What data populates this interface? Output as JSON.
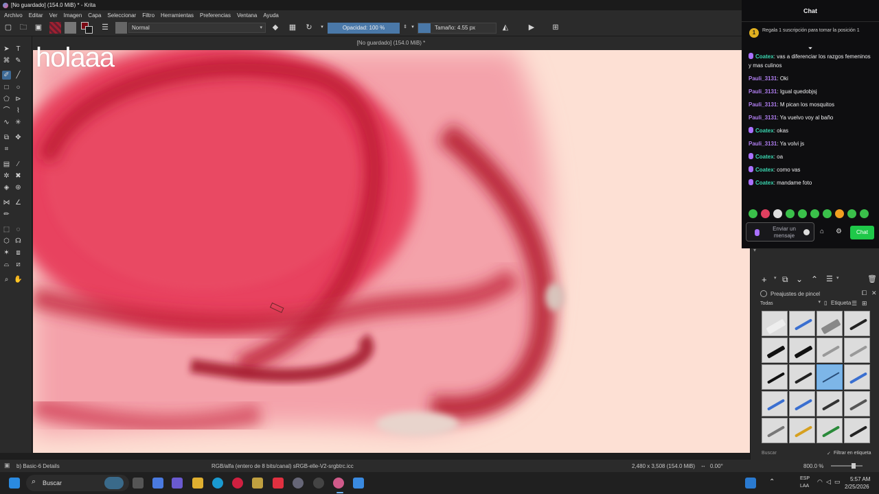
{
  "window": {
    "title": "[No guardado]  (154.0 MiB) * - Krita"
  },
  "menu": {
    "items": [
      "Archivo",
      "Editar",
      "Ver",
      "Imagen",
      "Capa",
      "Seleccionar",
      "Filtro",
      "Herramientas",
      "Preferencias",
      "Ventana",
      "Ayuda"
    ]
  },
  "toolbar": {
    "blend_mode": "Normal",
    "opacity_label": "Opacidad: 100 %",
    "opacity": 1.0,
    "size_label": "Tamaño: 4.55 px",
    "colors": {
      "foreground": "#7a0a14",
      "background": "#1a1a1a",
      "accent": "#4a78a8"
    }
  },
  "canvas": {
    "doc_title": "[No guardado]  (154.0 MiB) *",
    "overlay_text": "holaaa",
    "colors": {
      "paper": "#fde0d4",
      "blush": "#e8435e",
      "deep": "#b3122a"
    }
  },
  "chat": {
    "header": "Chat",
    "pinned_badge": "1",
    "pinned_text": "Regala 1 suscripción para tomar la posición 1",
    "messages": [
      {
        "user": "Coatex",
        "text": ": vas a diferenciar los razgos femeninos y mas culinos",
        "mic": true
      },
      {
        "user": "Pauli_3131",
        "text": ": Oki",
        "mic": false
      },
      {
        "user": "Pauli_3131",
        "text": ": Igual quedobjsj",
        "mic": false
      },
      {
        "user": "Pauli_3131",
        "text": ": M pican los mosquitos",
        "mic": false
      },
      {
        "user": "Pauli_3131",
        "text": ": Ya vuelvo voy al baño",
        "mic": false
      },
      {
        "user": "Coatex",
        "text": ": okas",
        "mic": true
      },
      {
        "user": "Pauli_3131",
        "text": ": Ya volvi js",
        "mic": false
      },
      {
        "user": "Coatex",
        "text": ": oa",
        "mic": true
      },
      {
        "user": "Coatex",
        "text": ": como vas",
        "mic": true
      },
      {
        "user": "Coatex",
        "text": ": mandame foto",
        "mic": true
      }
    ],
    "send_placeholder": "Enviar un mensaje",
    "chat_button": "Chat"
  },
  "brush_presets": {
    "title": "Preajustes de pincel",
    "filter_value": "Todas",
    "tag_label": "Etiqueta",
    "search_placeholder": "Buscar",
    "filter_in_tag": "Filtrar en etiqueta"
  },
  "status": {
    "brush_name": "b) Basic-6 Details",
    "color_profile": "RGB/alfa (entero de 8 bits/canal)  sRGB-elle-V2-srgbtrc.icc",
    "image_size": "2,480 x 3,508 (154.0 MiB)",
    "rotation": "0.00°",
    "zoom": "800.0 %"
  },
  "taskbar": {
    "search_label": "Buscar",
    "lang_top": "ESP",
    "lang_bottom": "LAA",
    "time": "5:57 AM",
    "date": "2/25/2026"
  }
}
